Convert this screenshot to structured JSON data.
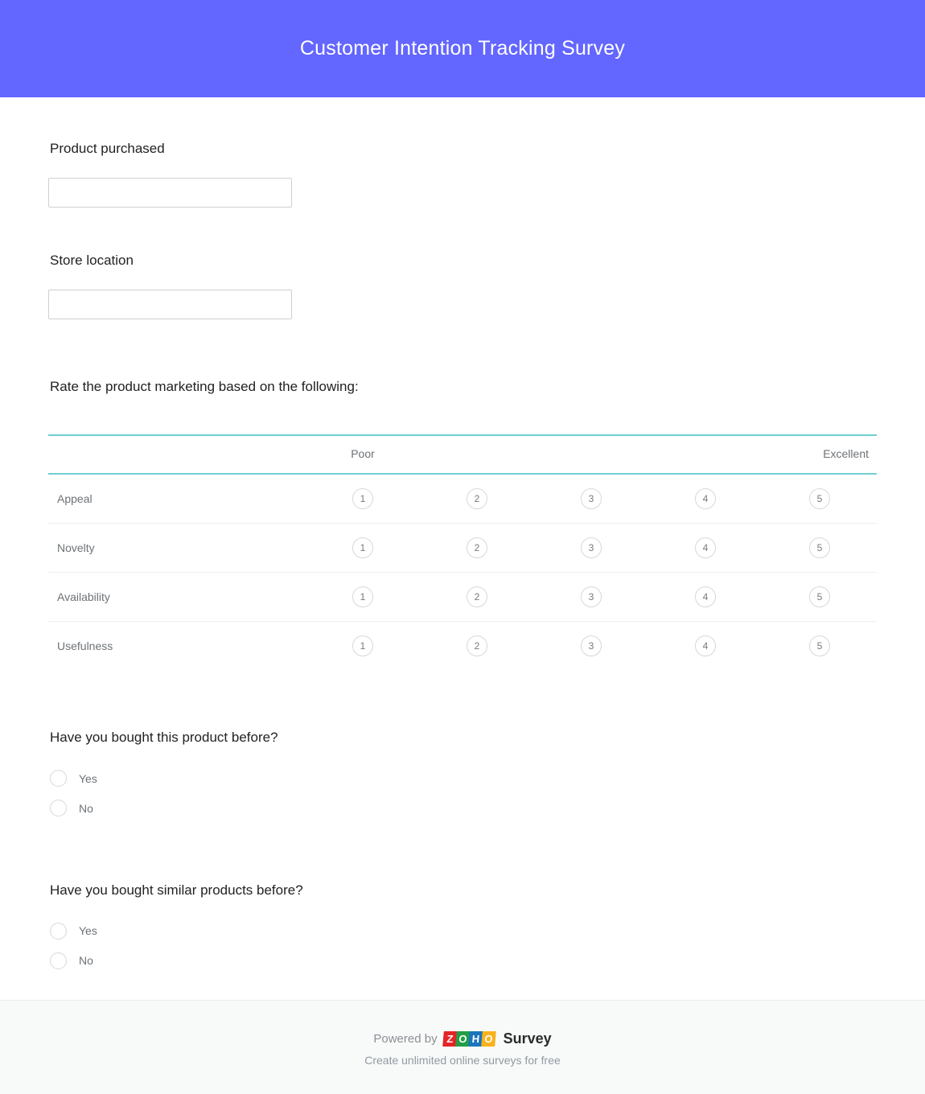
{
  "header": {
    "title": "Customer Intention Tracking Survey",
    "background_color": "#6366FF",
    "title_color": "#FFFFFF"
  },
  "theme": {
    "accent_color": "#6366FF",
    "matrix_rule_color": "#6FCFD0",
    "muted_text_color": "#6D7276",
    "border_color": "#D6D8DA"
  },
  "questions": {
    "product_purchased": {
      "label": "Product purchased",
      "value": "",
      "placeholder": ""
    },
    "store_location": {
      "label": "Store location",
      "value": "",
      "placeholder": ""
    },
    "marketing_rating": {
      "label": "Rate the product marketing based on the following:",
      "scale_low_label": "Poor",
      "scale_high_label": "Excellent",
      "scale_points": [
        "1",
        "2",
        "3",
        "4",
        "5"
      ],
      "rows": [
        {
          "label": "Appeal"
        },
        {
          "label": "Novelty"
        },
        {
          "label": "Availability"
        },
        {
          "label": "Usefulness"
        }
      ]
    },
    "bought_before": {
      "label": "Have you bought this product before?",
      "options": [
        {
          "label": "Yes",
          "selected": false
        },
        {
          "label": "No",
          "selected": false
        }
      ]
    },
    "bought_similar": {
      "label": "Have you bought similar products before?",
      "options": [
        {
          "label": "Yes",
          "selected": false
        },
        {
          "label": "No",
          "selected": false
        }
      ]
    }
  },
  "footer": {
    "powered_by": "Powered by",
    "brand_tiles": [
      "Z",
      "O",
      "H",
      "O"
    ],
    "brand_suffix": "Survey",
    "tagline": "Create unlimited online surveys for free"
  }
}
